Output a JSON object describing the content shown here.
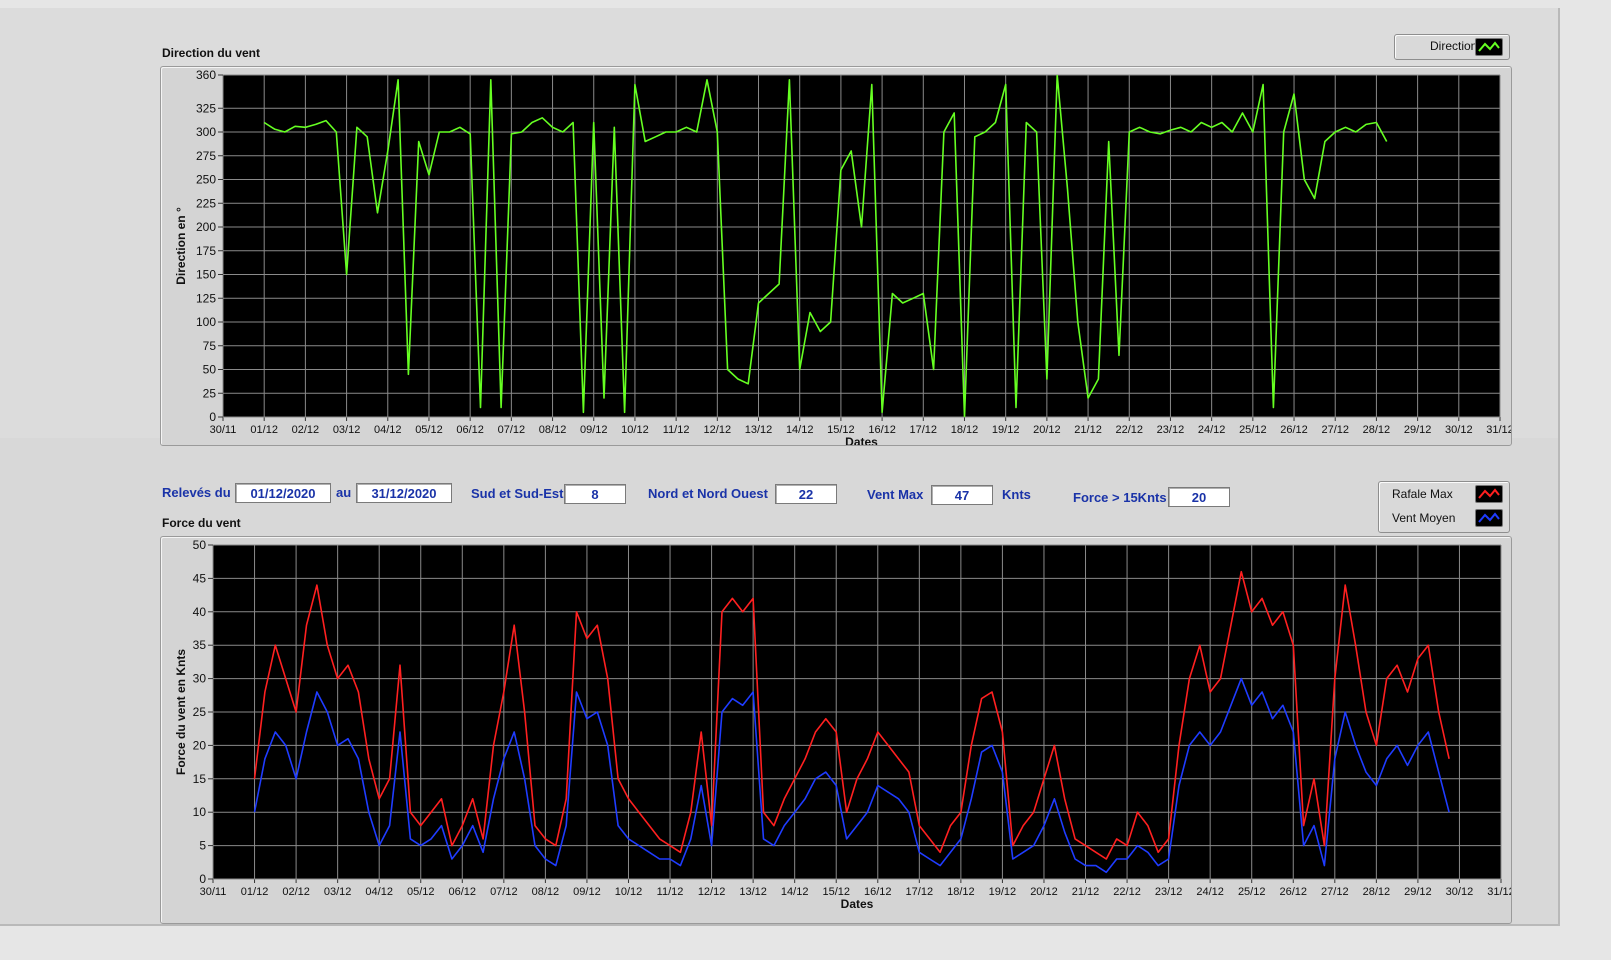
{
  "controls": {
    "releves_label": "Relevés du",
    "date_from": "01/12/2020",
    "au_label": "au",
    "date_to": "31/12/2020",
    "sud_label": "Sud et Sud-Est",
    "sud_value": "8",
    "nord_label": "Nord et Nord Ouest",
    "nord_value": "22",
    "ventmax_label": "Vent Max",
    "ventmax_value": "47",
    "knts_label": "Knts",
    "force_label": "Force > 15Knts",
    "force_value": "20"
  },
  "chart_data": [
    {
      "type": "line",
      "title": "Direction du vent",
      "xlabel": "Dates",
      "ylabel": "Direction en °",
      "xlim": [
        "30/11",
        "31/12"
      ],
      "ylim": [
        0,
        360
      ],
      "grid": true,
      "legend_placement": "top-right",
      "x_ticks": [
        "30/11",
        "01/12",
        "02/12",
        "03/12",
        "04/12",
        "05/12",
        "06/12",
        "07/12",
        "08/12",
        "09/12",
        "10/12",
        "11/12",
        "12/12",
        "13/12",
        "14/12",
        "15/12",
        "16/12",
        "17/12",
        "18/12",
        "19/12",
        "20/12",
        "21/12",
        "22/12",
        "23/12",
        "24/12",
        "25/12",
        "26/12",
        "27/12",
        "28/12",
        "29/12",
        "30/12",
        "31/12"
      ],
      "y_ticks": [
        0,
        25,
        50,
        75,
        100,
        125,
        150,
        175,
        200,
        225,
        250,
        275,
        300,
        325,
        360
      ],
      "series": [
        {
          "name": "Direction",
          "color": "#66ff22",
          "x_start": "01/12",
          "step_days": 0.25,
          "values": [
            310,
            303,
            300,
            306,
            305,
            308,
            312,
            300,
            150,
            305,
            295,
            215,
            280,
            355,
            45,
            290,
            255,
            300,
            300,
            305,
            298,
            10,
            355,
            10,
            298,
            300,
            310,
            315,
            305,
            300,
            310,
            5,
            310,
            20,
            305,
            5,
            350,
            290,
            295,
            300,
            300,
            305,
            300,
            355,
            300,
            50,
            40,
            35,
            120,
            130,
            140,
            355,
            50,
            110,
            90,
            100,
            260,
            280,
            200,
            350,
            5,
            130,
            120,
            125,
            130,
            50,
            300,
            320,
            0,
            295,
            300,
            310,
            350,
            10,
            310,
            300,
            40,
            360,
            240,
            100,
            20,
            40,
            290,
            65,
            300,
            305,
            300,
            298,
            302,
            305,
            300,
            310,
            305,
            310,
            300,
            320,
            300,
            350,
            10,
            300,
            340,
            250,
            230,
            290,
            300,
            305,
            300,
            308,
            310,
            290
          ]
        }
      ]
    },
    {
      "type": "line",
      "title": "Force du vent",
      "xlabel": "Dates",
      "ylabel": "Force du vent en Knts",
      "xlim": [
        "30/11",
        "31/12"
      ],
      "ylim": [
        0,
        50
      ],
      "grid": true,
      "legend_placement": "top-right",
      "x_ticks": [
        "30/11",
        "01/12",
        "02/12",
        "03/12",
        "04/12",
        "05/12",
        "06/12",
        "07/12",
        "08/12",
        "09/12",
        "10/12",
        "11/12",
        "12/12",
        "13/12",
        "14/12",
        "15/12",
        "16/12",
        "17/12",
        "18/12",
        "19/12",
        "20/12",
        "21/12",
        "22/12",
        "23/12",
        "24/12",
        "25/12",
        "26/12",
        "27/12",
        "28/12",
        "29/12",
        "30/12",
        "31/12"
      ],
      "y_ticks": [
        0,
        5,
        10,
        15,
        20,
        25,
        30,
        35,
        40,
        45,
        50
      ],
      "series": [
        {
          "name": "Rafale Max",
          "color": "#ff2020",
          "x_start": "01/12",
          "step_days": 0.25,
          "values": [
            15,
            28,
            35,
            30,
            25,
            38,
            44,
            35,
            30,
            32,
            28,
            18,
            12,
            15,
            32,
            10,
            8,
            10,
            12,
            5,
            8,
            12,
            6,
            20,
            28,
            38,
            25,
            8,
            6,
            5,
            12,
            40,
            36,
            38,
            30,
            15,
            12,
            10,
            8,
            6,
            5,
            4,
            10,
            22,
            8,
            40,
            42,
            40,
            42,
            10,
            8,
            12,
            15,
            18,
            22,
            24,
            22,
            10,
            15,
            18,
            22,
            20,
            18,
            16,
            8,
            6,
            4,
            8,
            10,
            20,
            27,
            28,
            22,
            5,
            8,
            10,
            15,
            20,
            12,
            6,
            5,
            4,
            3,
            6,
            5,
            10,
            8,
            4,
            6,
            20,
            30,
            35,
            28,
            30,
            38,
            46,
            40,
            42,
            38,
            40,
            35,
            8,
            15,
            5,
            30,
            44,
            35,
            25,
            20,
            30,
            32,
            28,
            33,
            35,
            25,
            18
          ]
        },
        {
          "name": "Vent Moyen",
          "color": "#1f3cff",
          "x_start": "01/12",
          "step_days": 0.25,
          "values": [
            10,
            18,
            22,
            20,
            15,
            22,
            28,
            25,
            20,
            21,
            18,
            10,
            5,
            8,
            22,
            6,
            5,
            6,
            8,
            3,
            5,
            8,
            4,
            12,
            18,
            22,
            15,
            5,
            3,
            2,
            8,
            28,
            24,
            25,
            20,
            8,
            6,
            5,
            4,
            3,
            3,
            2,
            6,
            14,
            5,
            25,
            27,
            26,
            28,
            6,
            5,
            8,
            10,
            12,
            15,
            16,
            14,
            6,
            8,
            10,
            14,
            13,
            12,
            10,
            4,
            3,
            2,
            4,
            6,
            12,
            19,
            20,
            16,
            3,
            4,
            5,
            8,
            12,
            7,
            3,
            2,
            2,
            1,
            3,
            3,
            5,
            4,
            2,
            3,
            14,
            20,
            22,
            20,
            22,
            26,
            30,
            26,
            28,
            24,
            26,
            22,
            5,
            8,
            2,
            18,
            25,
            20,
            16,
            14,
            18,
            20,
            17,
            20,
            22,
            16,
            10
          ]
        }
      ]
    }
  ]
}
